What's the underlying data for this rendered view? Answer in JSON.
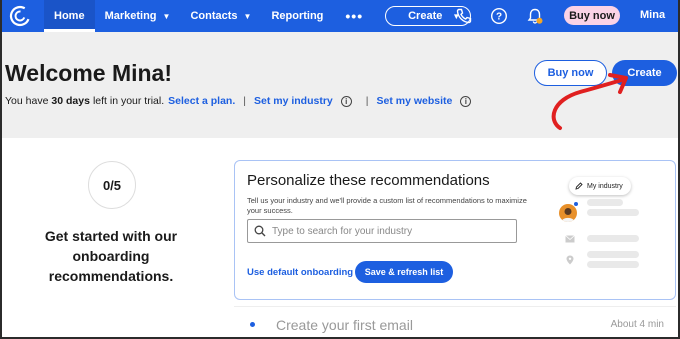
{
  "nav": {
    "items": [
      {
        "label": "Home",
        "active": true,
        "dropdown": false
      },
      {
        "label": "Marketing",
        "active": false,
        "dropdown": true
      },
      {
        "label": "Contacts",
        "active": false,
        "dropdown": true
      },
      {
        "label": "Reporting",
        "active": false,
        "dropdown": false
      }
    ],
    "more_label": "•••",
    "create_label": "Create",
    "buy_now_label": "Buy now",
    "user_label": "Mina",
    "icons": [
      "phone-icon",
      "help-icon",
      "notification-bell-icon"
    ],
    "brand_color": "#1d5fe0"
  },
  "header": {
    "welcome": "Welcome Mina!",
    "trial_prefix": "You have",
    "trial_days": "30 days",
    "trial_suffix": "left in your trial.",
    "select_plan": "Select a plan.",
    "sep": "|",
    "set_industry": "Set my industry",
    "set_website": "Set my website",
    "buy_now": "Buy now",
    "create": "Create"
  },
  "onboarding": {
    "progress": "0/5",
    "title": "Get started with our onboarding recommendations."
  },
  "recommendations": {
    "title": "Personalize these recommendations",
    "description": "Tell us your industry and we'll provide a custom list of recommendations to maximize your success.",
    "search_placeholder": "Type to search for your industry",
    "use_default": "Use default onboarding",
    "save_refresh": "Save & refresh list",
    "industry_chip": "My industry"
  },
  "tasks": [
    {
      "title": "Create your first email",
      "time": "About 4 min"
    }
  ]
}
